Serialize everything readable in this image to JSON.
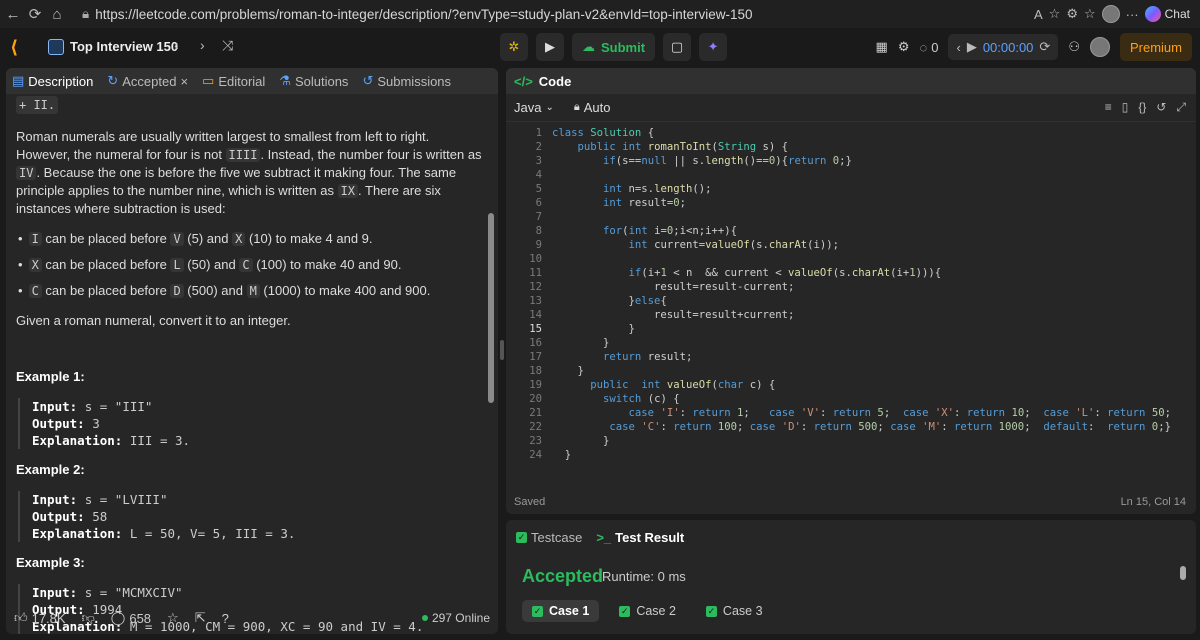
{
  "browser": {
    "url": "https://leetcode.com/problems/roman-to-integer/description/?envType=study-plan-v2&envId=top-interview-150",
    "chat_label": "Chat"
  },
  "topbar": {
    "list_title": "Top Interview 150",
    "submit_label": "Submit",
    "streak": "0",
    "timer": "00:00:00",
    "premium_label": "Premium"
  },
  "left_tabs": [
    {
      "label": "Description"
    },
    {
      "label": "Accepted"
    },
    {
      "label": "Editorial"
    },
    {
      "label": "Solutions"
    },
    {
      "label": "Submissions"
    }
  ],
  "description": {
    "top_snippet": "+ II.",
    "para1_a": "Roman numerals are usually written largest to smallest from left to right. However, the numeral for four is not ",
    "para1_code1": "IIII",
    "para1_b": ". Instead, the number four is written as ",
    "para1_code2": "IV",
    "para1_c": ". Because the one is before the five we subtract it making four. The same principle applies to the number nine, which is written as ",
    "para1_code3": "IX",
    "para1_d": ". There are six instances where subtraction is used:",
    "bullets": [
      {
        "c1": "I",
        "t1": " can be placed before ",
        "c2": "V",
        "t2": " (5) and ",
        "c3": "X",
        "t3": " (10) to make 4 and 9."
      },
      {
        "c1": "X",
        "t1": " can be placed before ",
        "c2": "L",
        "t2": " (50) and ",
        "c3": "C",
        "t3": " (100) to make 40 and 90."
      },
      {
        "c1": "C",
        "t1": " can be placed before ",
        "c2": "D",
        "t2": " (500) and ",
        "c3": "M",
        "t3": " (1000) to make 400 and 900."
      }
    ],
    "task": "Given a roman numeral, convert it to an integer.",
    "examples": [
      {
        "title": "Example 1:",
        "input": "s = \"III\"",
        "output": "3",
        "explanation": "III = 3."
      },
      {
        "title": "Example 2:",
        "input": "s = \"LVIII\"",
        "output": "58",
        "explanation": "L = 50, V= 5, III = 3."
      },
      {
        "title": "Example 3:",
        "input": "s = \"MCMXCIV\"",
        "output": "1994",
        "explanation": "M = 1000, CM = 900, XC = 90 and IV = 4."
      }
    ],
    "input_label": "Input:",
    "output_label": "Output:",
    "explanation_label": "Explanation:"
  },
  "left_footer": {
    "likes": "17.8K",
    "comments": "658",
    "online": "297 Online"
  },
  "code_panel": {
    "title": "Code",
    "language": "Java",
    "mode": "Auto",
    "saved": "Saved",
    "cursor": "Ln 15, Col 14"
  },
  "result_panel": {
    "tab_testcase": "Testcase",
    "tab_result": "Test Result",
    "status": "Accepted",
    "runtime": "Runtime: 0 ms",
    "cases": [
      "Case 1",
      "Case 2",
      "Case 3"
    ]
  }
}
